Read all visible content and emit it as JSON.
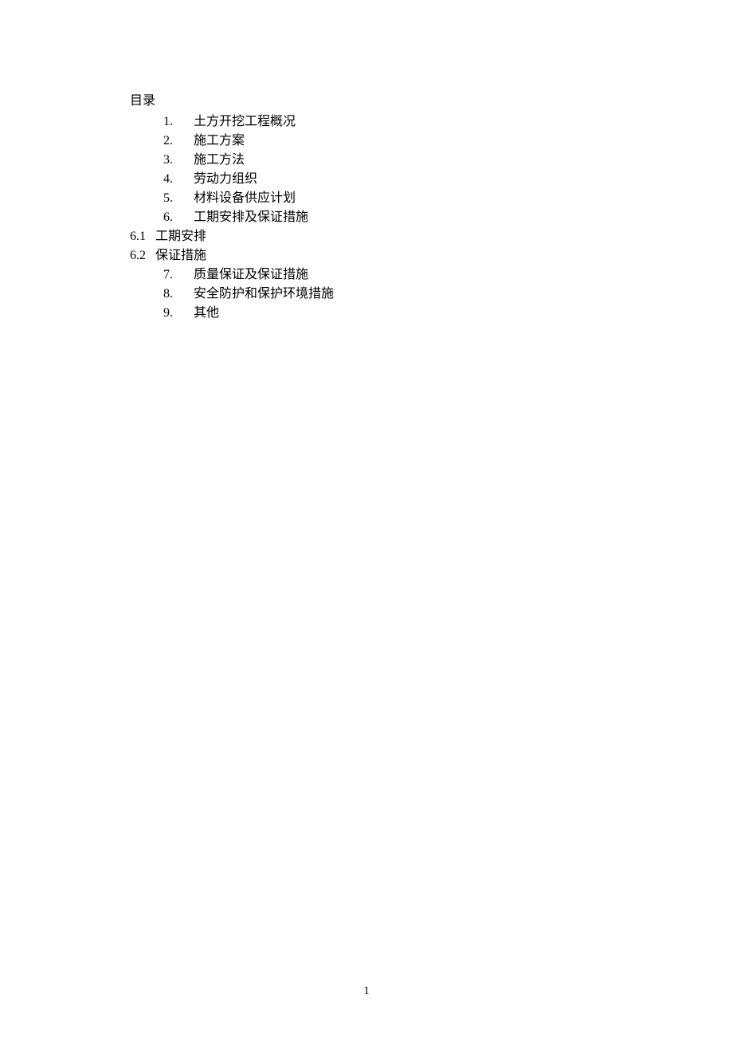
{
  "toc": {
    "title": "目录",
    "items": [
      {
        "num": "1.",
        "text": "土方开挖工程概况",
        "indent": true
      },
      {
        "num": "2.",
        "text": "施工方案",
        "indent": true
      },
      {
        "num": "3.",
        "text": "施工方法",
        "indent": true
      },
      {
        "num": "4.",
        "text": "劳动力组织",
        "indent": true
      },
      {
        "num": "5.",
        "text": "材料设备供应计划",
        "indent": true
      },
      {
        "num": "6.",
        "text": "工期安排及保证措施",
        "indent": true
      },
      {
        "num": "6.1",
        "text": "工期安排",
        "indent": false
      },
      {
        "num": "6.2",
        "text": "保证措施",
        "indent": false
      },
      {
        "num": "7.",
        "text": "质量保证及保证措施",
        "indent": true
      },
      {
        "num": "8.",
        "text": "安全防护和保护环境措施",
        "indent": true
      },
      {
        "num": "9.",
        "text": "其他",
        "indent": true
      }
    ]
  },
  "page_number": "1"
}
